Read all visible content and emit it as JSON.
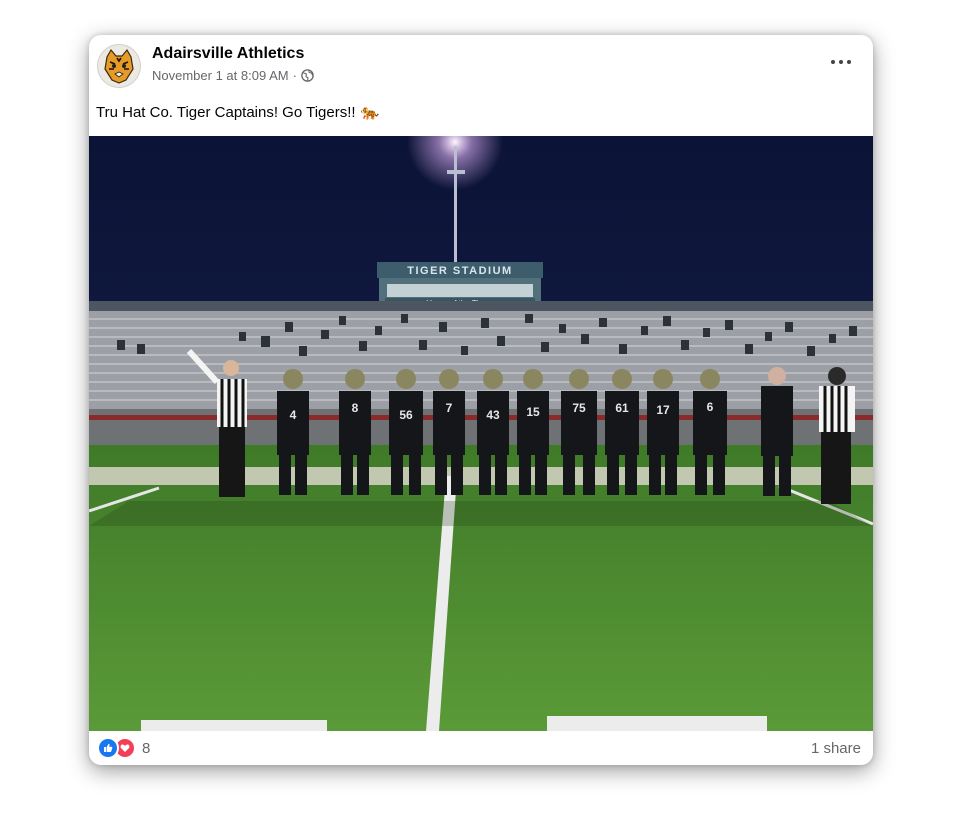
{
  "post": {
    "page_name": "Adairsville Athletics",
    "timestamp": "November 1 at 8:09 AM",
    "separator": "·",
    "audience_icon": "globe-icon",
    "more_icon": "more-options-icon",
    "caption": "Tru Hat Co. Tiger Captains! Go Tigers!!",
    "caption_emoji": "🐅"
  },
  "photo": {
    "stadium_sign": "TIGER STADIUM",
    "stadium_subsign": "Home of the Tigers",
    "jersey_numbers": [
      "4",
      "8",
      "56",
      "7",
      "43",
      "15",
      "75",
      "61",
      "17",
      "6"
    ]
  },
  "footer": {
    "reaction_icons": [
      "like-icon",
      "love-icon"
    ],
    "reaction_count": "8",
    "share_text": "1 share"
  },
  "colors": {
    "accent": "#1877f2",
    "love": "#f33e58",
    "secondary_text": "#65676b",
    "field_green": "#4e8a2e",
    "sky": "#0c1438"
  }
}
